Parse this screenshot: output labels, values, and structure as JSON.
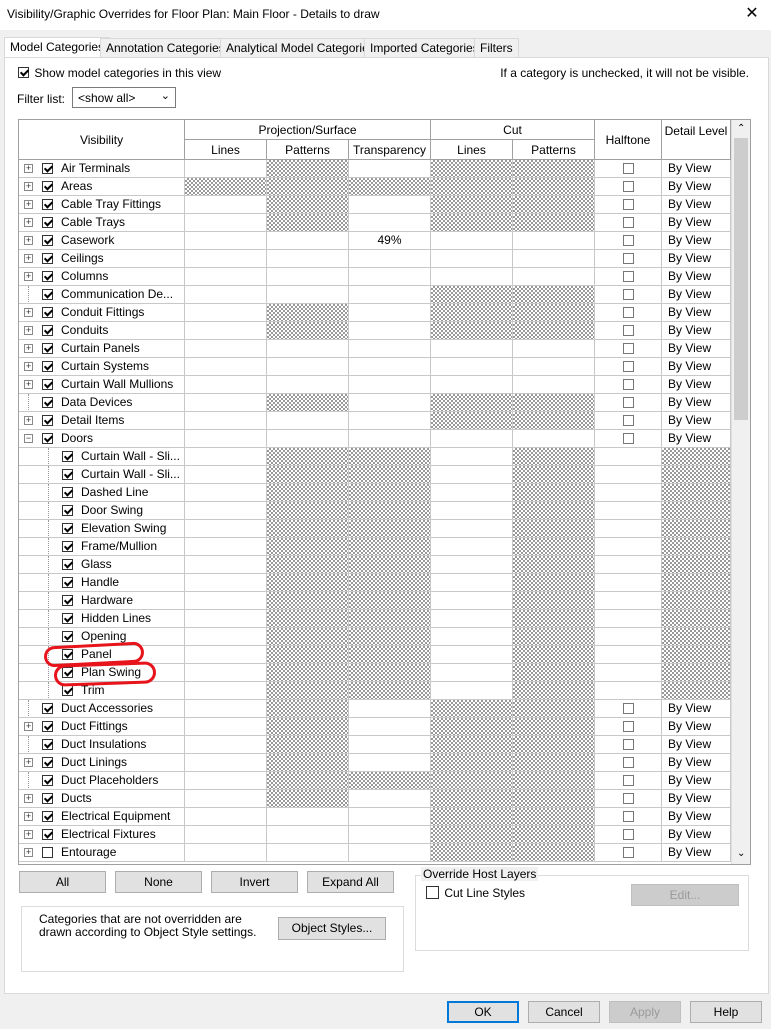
{
  "window": {
    "title": "Visibility/Graphic Overrides for Floor Plan: Main Floor - Details to draw",
    "close_glyph": "✕"
  },
  "tabs": [
    "Model Categories",
    "Annotation Categories",
    "Analytical Model Categories",
    "Imported Categories",
    "Filters"
  ],
  "show_categories": {
    "label": "Show model categories in this view",
    "checked": true
  },
  "info_text": "If a category is unchecked, it will not be visible.",
  "filter": {
    "label": "Filter list:",
    "value": "<show all>"
  },
  "headers": {
    "visibility": "Visibility",
    "projection": "Projection/Surface",
    "cut": "Cut",
    "halftone": "Halftone",
    "detail_level": "Detail Level",
    "lines": "Lines",
    "patterns": "Patterns",
    "transparency": "Transparency",
    "cut_lines": "Lines",
    "cut_patterns": "Patterns"
  },
  "rows": [
    {
      "name": "Air Terminals",
      "level": 0,
      "expander": "+",
      "checked": true,
      "detail": "By View",
      "ht": true,
      "hatch": [
        0,
        1,
        0,
        1,
        1
      ]
    },
    {
      "name": "Areas",
      "level": 0,
      "expander": "+",
      "checked": true,
      "detail": "By View",
      "ht": true,
      "hatch": [
        1,
        1,
        1,
        1,
        1
      ]
    },
    {
      "name": "Cable Tray Fittings",
      "level": 0,
      "expander": "+",
      "checked": true,
      "detail": "By View",
      "ht": true,
      "hatch": [
        0,
        1,
        0,
        1,
        1
      ]
    },
    {
      "name": "Cable Trays",
      "level": 0,
      "expander": "+",
      "checked": true,
      "detail": "By View",
      "ht": true,
      "hatch": [
        0,
        1,
        0,
        1,
        1
      ]
    },
    {
      "name": "Casework",
      "level": 0,
      "expander": "+",
      "checked": true,
      "detail": "By View",
      "ht": true,
      "hatch": [
        0,
        0,
        0,
        0,
        0
      ],
      "transparency": "49%"
    },
    {
      "name": "Ceilings",
      "level": 0,
      "expander": "+",
      "checked": true,
      "detail": "By View",
      "ht": true,
      "hatch": [
        0,
        0,
        0,
        0,
        0
      ]
    },
    {
      "name": "Columns",
      "level": 0,
      "expander": "+",
      "checked": true,
      "detail": "By View",
      "ht": true,
      "hatch": [
        0,
        0,
        0,
        0,
        0
      ]
    },
    {
      "name": "Communication De...",
      "level": 0,
      "expander": "",
      "checked": true,
      "detail": "By View",
      "ht": true,
      "hatch": [
        0,
        0,
        0,
        1,
        1
      ]
    },
    {
      "name": "Conduit Fittings",
      "level": 0,
      "expander": "+",
      "checked": true,
      "detail": "By View",
      "ht": true,
      "hatch": [
        0,
        1,
        0,
        1,
        1
      ]
    },
    {
      "name": "Conduits",
      "level": 0,
      "expander": "+",
      "checked": true,
      "detail": "By View",
      "ht": true,
      "hatch": [
        0,
        1,
        0,
        1,
        1
      ]
    },
    {
      "name": "Curtain Panels",
      "level": 0,
      "expander": "+",
      "checked": true,
      "detail": "By View",
      "ht": true,
      "hatch": [
        0,
        0,
        0,
        0,
        0
      ]
    },
    {
      "name": "Curtain Systems",
      "level": 0,
      "expander": "+",
      "checked": true,
      "detail": "By View",
      "ht": true,
      "hatch": [
        0,
        0,
        0,
        0,
        0
      ]
    },
    {
      "name": "Curtain Wall Mullions",
      "level": 0,
      "expander": "+",
      "checked": true,
      "detail": "By View",
      "ht": true,
      "hatch": [
        0,
        0,
        0,
        0,
        0
      ]
    },
    {
      "name": "Data Devices",
      "level": 0,
      "expander": "",
      "checked": true,
      "detail": "By View",
      "ht": true,
      "hatch": [
        0,
        1,
        0,
        1,
        1
      ]
    },
    {
      "name": "Detail Items",
      "level": 0,
      "expander": "+",
      "checked": true,
      "detail": "By View",
      "ht": true,
      "hatch": [
        0,
        0,
        0,
        1,
        1
      ]
    },
    {
      "name": "Doors",
      "level": 0,
      "expander": "−",
      "checked": true,
      "detail": "By View",
      "ht": true,
      "hatch": [
        0,
        0,
        0,
        0,
        0
      ]
    },
    {
      "name": "Curtain Wall - Sli...",
      "level": 1,
      "expander": "",
      "checked": true,
      "detail": "",
      "ht": false,
      "hatch": [
        0,
        1,
        1,
        0,
        1
      ]
    },
    {
      "name": "Curtain Wall - Sli...",
      "level": 1,
      "expander": "",
      "checked": true,
      "detail": "",
      "ht": false,
      "hatch": [
        0,
        1,
        1,
        0,
        1
      ]
    },
    {
      "name": "Dashed Line",
      "level": 1,
      "expander": "",
      "checked": true,
      "detail": "",
      "ht": false,
      "hatch": [
        0,
        1,
        1,
        0,
        1
      ]
    },
    {
      "name": "Door Swing",
      "level": 1,
      "expander": "",
      "checked": true,
      "detail": "",
      "ht": false,
      "hatch": [
        0,
        1,
        1,
        0,
        1
      ]
    },
    {
      "name": "Elevation Swing",
      "level": 1,
      "expander": "",
      "checked": true,
      "detail": "",
      "ht": false,
      "hatch": [
        0,
        1,
        1,
        0,
        1
      ]
    },
    {
      "name": "Frame/Mullion",
      "level": 1,
      "expander": "",
      "checked": true,
      "detail": "",
      "ht": false,
      "hatch": [
        0,
        1,
        1,
        0,
        1
      ]
    },
    {
      "name": "Glass",
      "level": 1,
      "expander": "",
      "checked": true,
      "detail": "",
      "ht": false,
      "hatch": [
        0,
        1,
        1,
        0,
        1
      ]
    },
    {
      "name": "Handle",
      "level": 1,
      "expander": "",
      "checked": true,
      "detail": "",
      "ht": false,
      "hatch": [
        0,
        1,
        1,
        0,
        1
      ]
    },
    {
      "name": "Hardware",
      "level": 1,
      "expander": "",
      "checked": true,
      "detail": "",
      "ht": false,
      "hatch": [
        0,
        1,
        1,
        0,
        1
      ]
    },
    {
      "name": "Hidden Lines",
      "level": 1,
      "expander": "",
      "checked": true,
      "detail": "",
      "ht": false,
      "hatch": [
        0,
        1,
        1,
        0,
        1
      ]
    },
    {
      "name": "Opening",
      "level": 1,
      "expander": "",
      "checked": true,
      "detail": "",
      "ht": false,
      "hatch": [
        0,
        1,
        1,
        0,
        1
      ]
    },
    {
      "name": "Panel",
      "level": 1,
      "expander": "",
      "checked": true,
      "detail": "",
      "ht": false,
      "hatch": [
        0,
        1,
        1,
        0,
        1
      ]
    },
    {
      "name": "Plan Swing",
      "level": 1,
      "expander": "",
      "checked": true,
      "detail": "",
      "ht": false,
      "hatch": [
        0,
        1,
        1,
        0,
        1
      ]
    },
    {
      "name": "Trim",
      "level": 1,
      "expander": "",
      "checked": true,
      "detail": "",
      "ht": false,
      "hatch": [
        0,
        1,
        1,
        0,
        1
      ]
    },
    {
      "name": "Duct Accessories",
      "level": 0,
      "expander": "",
      "checked": true,
      "detail": "By View",
      "ht": true,
      "hatch": [
        0,
        1,
        0,
        1,
        1
      ]
    },
    {
      "name": "Duct Fittings",
      "level": 0,
      "expander": "+",
      "checked": true,
      "detail": "By View",
      "ht": true,
      "hatch": [
        0,
        1,
        0,
        1,
        1
      ]
    },
    {
      "name": "Duct Insulations",
      "level": 0,
      "expander": "",
      "checked": true,
      "detail": "By View",
      "ht": true,
      "hatch": [
        0,
        1,
        0,
        1,
        1
      ]
    },
    {
      "name": "Duct Linings",
      "level": 0,
      "expander": "+",
      "checked": true,
      "detail": "By View",
      "ht": true,
      "hatch": [
        0,
        1,
        0,
        1,
        1
      ]
    },
    {
      "name": "Duct Placeholders",
      "level": 0,
      "expander": "",
      "checked": true,
      "detail": "By View",
      "ht": true,
      "hatch": [
        0,
        1,
        1,
        1,
        1
      ]
    },
    {
      "name": "Ducts",
      "level": 0,
      "expander": "+",
      "checked": true,
      "detail": "By View",
      "ht": true,
      "hatch": [
        0,
        1,
        0,
        1,
        1
      ]
    },
    {
      "name": "Electrical Equipment",
      "level": 0,
      "expander": "+",
      "checked": true,
      "detail": "By View",
      "ht": true,
      "hatch": [
        0,
        0,
        0,
        1,
        1
      ]
    },
    {
      "name": "Electrical Fixtures",
      "level": 0,
      "expander": "+",
      "checked": true,
      "detail": "By View",
      "ht": true,
      "hatch": [
        0,
        0,
        0,
        1,
        1
      ]
    },
    {
      "name": "Entourage",
      "level": 0,
      "expander": "+",
      "checked": false,
      "detail": "By View",
      "ht": true,
      "hatch": [
        0,
        0,
        0,
        1,
        1
      ]
    }
  ],
  "buttons": {
    "all": "All",
    "none": "None",
    "invert": "Invert",
    "expand_all": "Expand All",
    "object_styles": "Object Styles...",
    "edit": "Edit...",
    "ok": "OK",
    "cancel": "Cancel",
    "apply": "Apply",
    "help": "Help"
  },
  "override_host": {
    "title": "Override Host Layers",
    "cut_line_styles": "Cut Line Styles",
    "checked": false
  },
  "note": "Categories that are not overridden are drawn according to Object Style settings.",
  "colors": {
    "annotation_red": "#e8141c",
    "accent": "#0078d7"
  }
}
